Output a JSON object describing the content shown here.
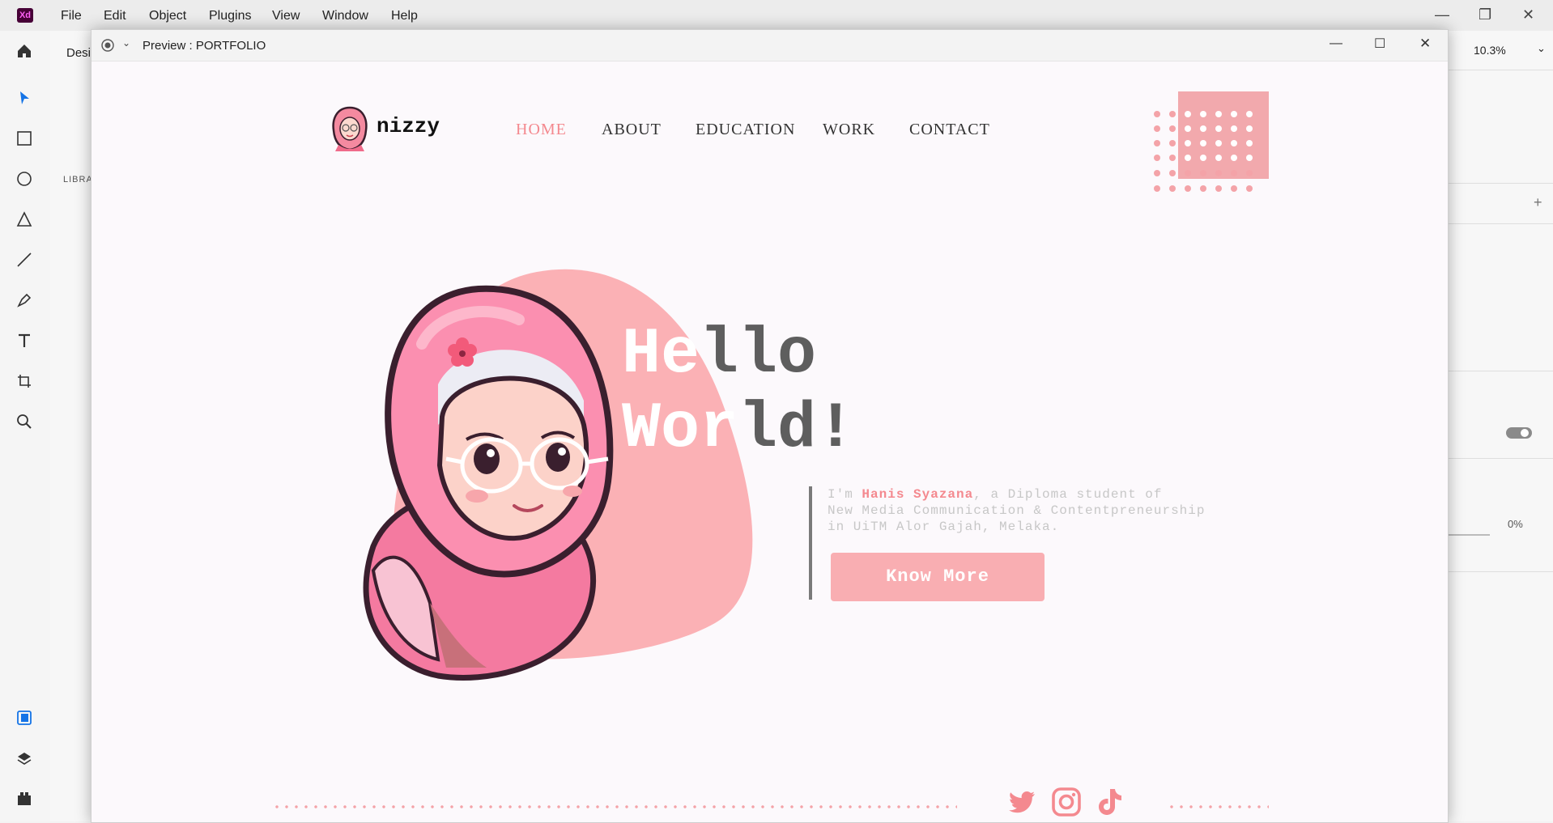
{
  "app": {
    "menu": [
      "File",
      "Edit",
      "Object",
      "Plugins",
      "View",
      "Window",
      "Help"
    ],
    "tab_partial": "Desi",
    "library_partial": "LIBRA",
    "zoom": "10.3%",
    "opacity": "0%"
  },
  "preview": {
    "title": "Preview : PORTFOLIO"
  },
  "site": {
    "logo": "nizzy",
    "nav": [
      "HOME",
      "ABOUT",
      "EDUCATION",
      "WORK",
      "CONTACT"
    ],
    "active_nav": "HOME",
    "hello_1a": "He",
    "hello_1b": "llo",
    "hello_2a": "Wor",
    "hello_2b": "ld!",
    "intro_pre": "I'm ",
    "intro_name": "Hanis Syazana",
    "intro_post": ", a Diploma student of",
    "intro_line2": "New Media Communication & Contentpreneurship",
    "intro_line3": "in UiTM Alor Gajah, Melaka.",
    "cta": "Know More",
    "social": [
      "twitter",
      "instagram",
      "tiktok"
    ]
  },
  "colors": {
    "accent": "#f4898f",
    "blob": "#f9aeb2",
    "dark_text": "#5e5e5e"
  }
}
